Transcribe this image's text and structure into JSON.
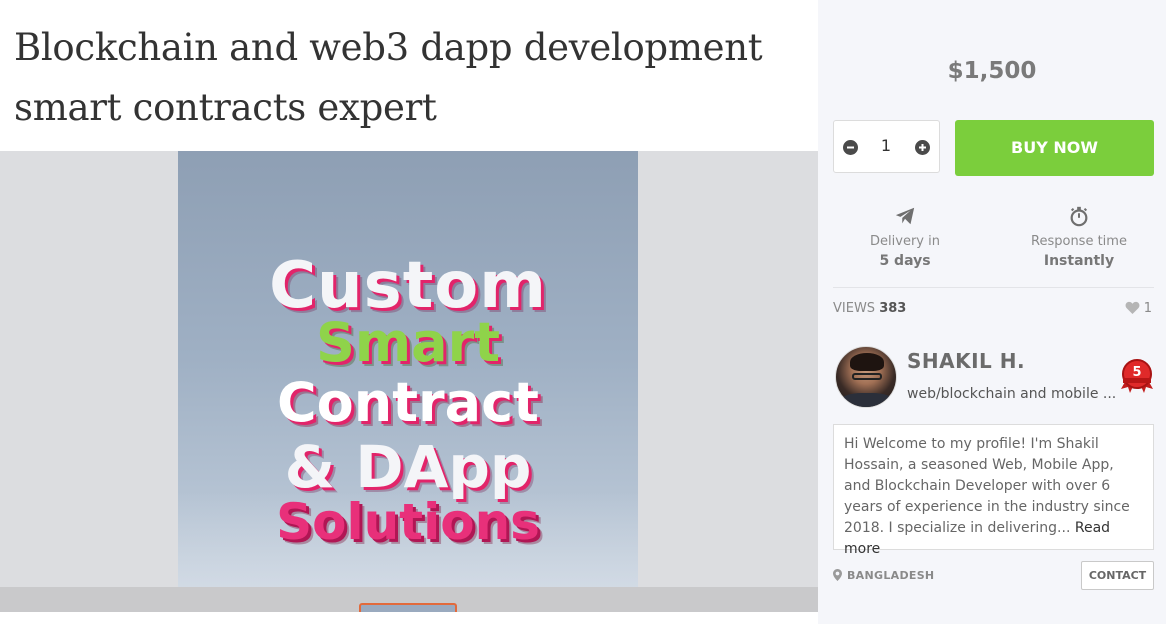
{
  "listing": {
    "title": "Blockchain and web3 dapp development smart contracts expert"
  },
  "cover": {
    "line1": "Custom",
    "line2": "Smart",
    "line3": "Contract",
    "line4": "& DApp",
    "line5": "Solutions"
  },
  "purchase": {
    "price": "$1,500",
    "quantity": "1",
    "buy_label": "BUY NOW",
    "buy_color": "#7bce3c"
  },
  "stats": {
    "delivery_label": "Delivery in",
    "delivery_value": "5 days",
    "delivery_icon": "paper-plane-icon",
    "response_label": "Response time",
    "response_value": "Instantly",
    "response_icon": "stopwatch-icon"
  },
  "engagement": {
    "views_label": "VIEWS",
    "views_count": "383",
    "likes_count": "1"
  },
  "seller": {
    "name": "SHAKIL H.",
    "subtitle": "web/blockchain and mobile ...",
    "badge_level": "5",
    "bio": "Hi Welcome to my profile! I'm Shakil Hossain, a seasoned Web, Mobile App, and Blockchain Developer with over 6 years of experience in the industry since 2018. I specialize in delivering...",
    "read_more": "Read more",
    "country": "BANGLADESH",
    "contact_label": "CONTACT"
  }
}
